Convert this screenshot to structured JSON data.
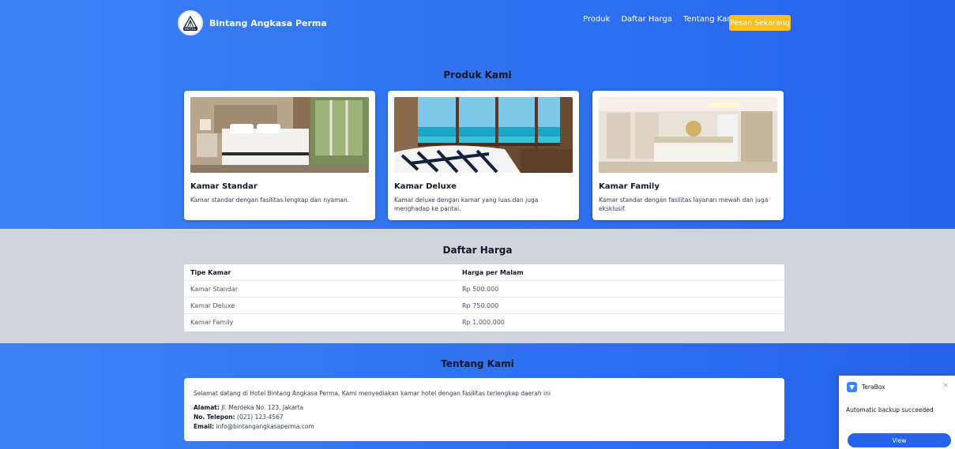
{
  "header": {
    "brand_name": "Bintang Angkasa Perma",
    "logo_label": "HOTEL",
    "nav": [
      "Produk",
      "Daftar Harga",
      "Tentang Kami"
    ],
    "cta_label": "Pesan Sekarang"
  },
  "produk": {
    "title": "Produk Kami",
    "cards": [
      {
        "title": "Kamar Standar",
        "desc": "Kamar standar dengan fasilitas lengkap dan nyaman."
      },
      {
        "title": "Kamar Deluxe",
        "desc": "Kamar deluxe dengan kamar yang luas dan juga menghadap ke pantai."
      },
      {
        "title": "Kamar Family",
        "desc": "Kamar standar dengan fasilitas layanan mewah dan juga eksklusif."
      }
    ]
  },
  "harga": {
    "title": "Daftar Harga",
    "columns": [
      "Tipe Kamar",
      "Harga per Malam"
    ],
    "rows": [
      [
        "Kamar Standar",
        "Rp 500.000"
      ],
      [
        "Kamar Deluxe",
        "Rp 750.000"
      ],
      [
        "Kamar Family",
        "Rp 1.000.000"
      ]
    ]
  },
  "tentang": {
    "title": "Tentang Kami",
    "intro": "Selamat datang di Hotel Bintang Angkasa Perma, Kami menyediakan kamar hotel dengan fasilitas terlengkap daerah ini",
    "alamat_label": "Alamat:",
    "alamat_value": "Jl. Merdeka No. 123, Jakarta",
    "telepon_label": "No. Telepon:",
    "telepon_value": "(021) 123-4567",
    "email_label": "Email:",
    "email_value": "info@bintangangkasaperma.com"
  },
  "toast": {
    "app_name": "TeraBox",
    "close_glyph": "×",
    "message": "Automatic backup succeeded",
    "button_label": "View"
  },
  "colors": {
    "primary": "#2563eb",
    "accent": "#fbbf24",
    "section_gray": "#d1d5db"
  }
}
